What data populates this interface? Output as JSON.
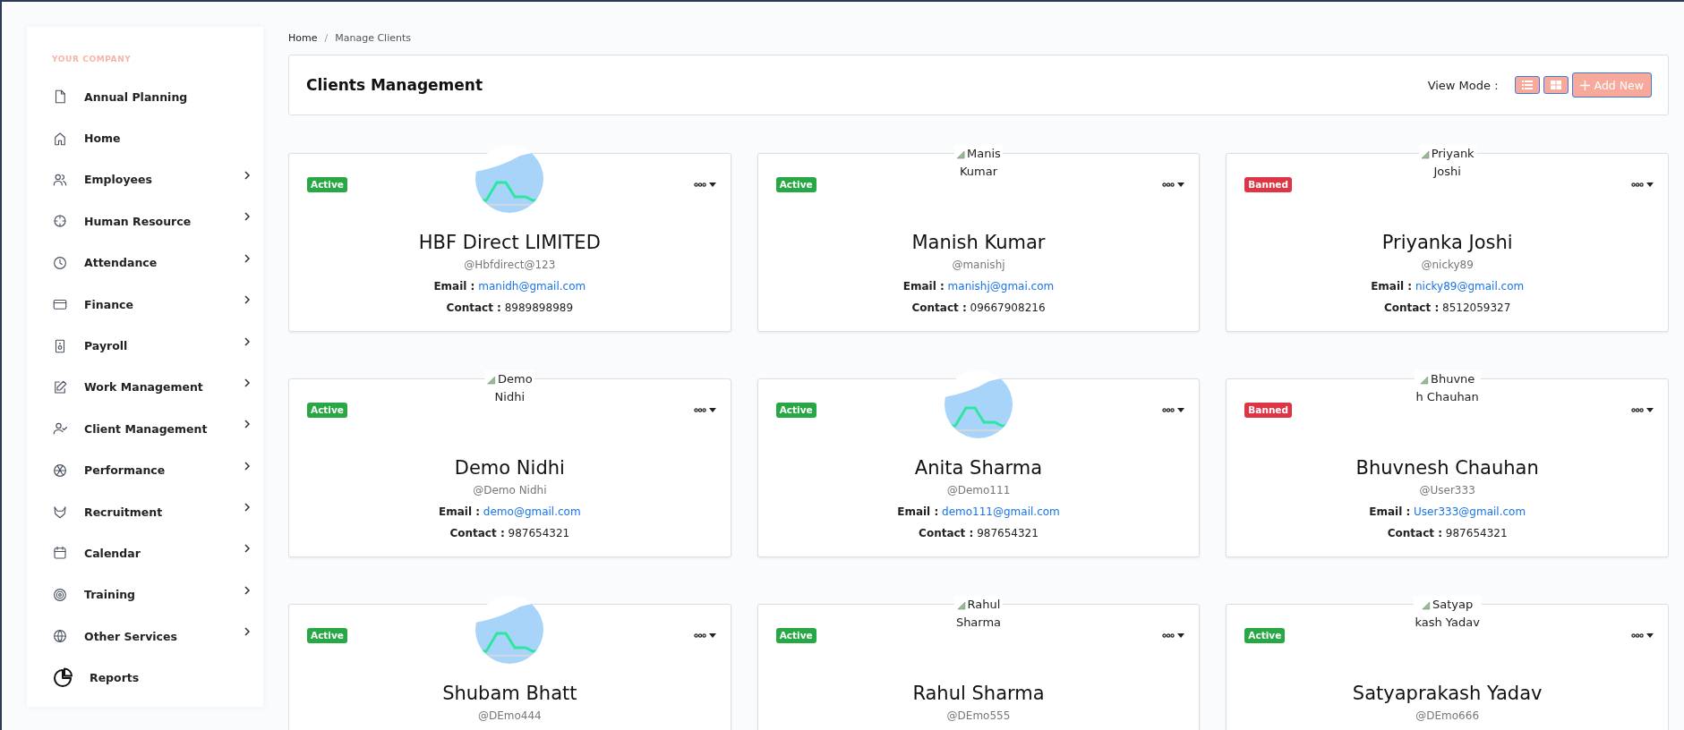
{
  "sidebar": {
    "company": "YOUR COMPANY",
    "items": [
      {
        "label": "Annual Planning",
        "has_submenu": false
      },
      {
        "label": "Home",
        "has_submenu": false
      },
      {
        "label": "Employees",
        "has_submenu": true
      },
      {
        "label": "Human Resource",
        "has_submenu": true
      },
      {
        "label": "Attendance",
        "has_submenu": true
      },
      {
        "label": "Finance",
        "has_submenu": true
      },
      {
        "label": "Payroll",
        "has_submenu": true
      },
      {
        "label": "Work Management",
        "has_submenu": true
      },
      {
        "label": "Client Management",
        "has_submenu": true
      },
      {
        "label": "Performance",
        "has_submenu": true
      },
      {
        "label": "Recruitment",
        "has_submenu": true
      },
      {
        "label": "Calendar",
        "has_submenu": true
      },
      {
        "label": "Training",
        "has_submenu": true
      },
      {
        "label": "Other Services",
        "has_submenu": true
      },
      {
        "label": "Reports",
        "has_submenu": false
      }
    ]
  },
  "breadcrumb": {
    "items": [
      "Home",
      "Manage Clients"
    ],
    "separator": "/"
  },
  "header": {
    "title": "Clients Management",
    "view_mode_label": "View Mode :",
    "add_button": "Add New"
  },
  "cards": [
    {
      "avatar": {
        "kind": "image"
      },
      "badge": {
        "text": "Active",
        "color": "#28a745"
      },
      "name": "HBF Direct LIMITED",
      "handle": "@Hbfdirect@123",
      "email_label": "Email :",
      "email": "manidh@gmail.com",
      "contact_label": "Contact :",
      "contact": "8989898989"
    },
    {
      "avatar": {
        "kind": "broken",
        "alt_lines": [
          "Manis",
          "Kumar"
        ]
      },
      "badge": {
        "text": "Active",
        "color": "#28a745"
      },
      "name": "Manish Kumar",
      "handle": "@manishj",
      "email_label": "Email :",
      "email": "manishj@gmai.com",
      "contact_label": "Contact :",
      "contact": "09667908216"
    },
    {
      "avatar": {
        "kind": "broken",
        "alt_lines": [
          "Priyank",
          "Joshi"
        ]
      },
      "badge": {
        "text": "Banned",
        "color": "#dc3545"
      },
      "name": "Priyanka Joshi",
      "handle": "@nicky89",
      "email_label": "Email :",
      "email": "nicky89@gmail.com",
      "contact_label": "Contact :",
      "contact": "8512059327"
    },
    {
      "avatar": {
        "kind": "broken",
        "alt_lines": [
          "Demo",
          "Nidhi"
        ]
      },
      "badge": {
        "text": "Active",
        "color": "#28a745"
      },
      "name": "Demo Nidhi",
      "handle": "@Demo Nidhi",
      "email_label": "Email :",
      "email": "demo@gmail.com",
      "contact_label": "Contact :",
      "contact": "987654321"
    },
    {
      "avatar": {
        "kind": "image"
      },
      "badge": {
        "text": "Active",
        "color": "#28a745"
      },
      "name": "Anita Sharma",
      "handle": "@Demo111",
      "email_label": "Email :",
      "email": "demo111@gmail.com",
      "contact_label": "Contact :",
      "contact": "987654321"
    },
    {
      "avatar": {
        "kind": "broken",
        "alt_lines": [
          "Bhuvne",
          "h Chauhan"
        ]
      },
      "badge": {
        "text": "Banned",
        "color": "#dc3545"
      },
      "name": "Bhuvnesh Chauhan",
      "handle": "@User333",
      "email_label": "Email :",
      "email": "User333@gmail.com",
      "contact_label": "Contact :",
      "contact": "987654321"
    },
    {
      "avatar": {
        "kind": "image"
      },
      "badge": {
        "text": "Active",
        "color": "#28a745"
      },
      "name": "Shubam Bhatt",
      "handle": "@DEmo444"
    },
    {
      "avatar": {
        "kind": "broken",
        "alt_lines": [
          "Rahul",
          "Sharma"
        ]
      },
      "badge": {
        "text": "Active",
        "color": "#28a745"
      },
      "name": "Rahul Sharma",
      "handle": "@DEmo555"
    },
    {
      "avatar": {
        "kind": "broken",
        "alt_lines": [
          "Satyap",
          "kash Yadav"
        ]
      },
      "badge": {
        "text": "Active",
        "color": "#28a745"
      },
      "name": "Satyaprakash Yadav",
      "handle": "@DEmo666"
    }
  ]
}
